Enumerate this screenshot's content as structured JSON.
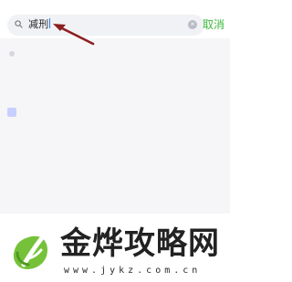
{
  "search": {
    "query": "减刑",
    "clear_symbol": "×",
    "cancel_label": "取消"
  },
  "history": {
    "label": ""
  },
  "results": [
    {
      "title": "",
      "meta": ""
    },
    {
      "title": "",
      "meta": ""
    }
  ],
  "watermark": {
    "title": "金烨攻略网",
    "url": "www.jykz.com.cn"
  },
  "colors": {
    "accent": "#3bb83b",
    "arrow": "#8b1f1f",
    "cursor": "#2a7df4"
  },
  "icons": {
    "search": "search-icon",
    "clear": "clear-icon",
    "annotation": "red-arrow-icon",
    "logo": "leaf-logo-icon"
  }
}
